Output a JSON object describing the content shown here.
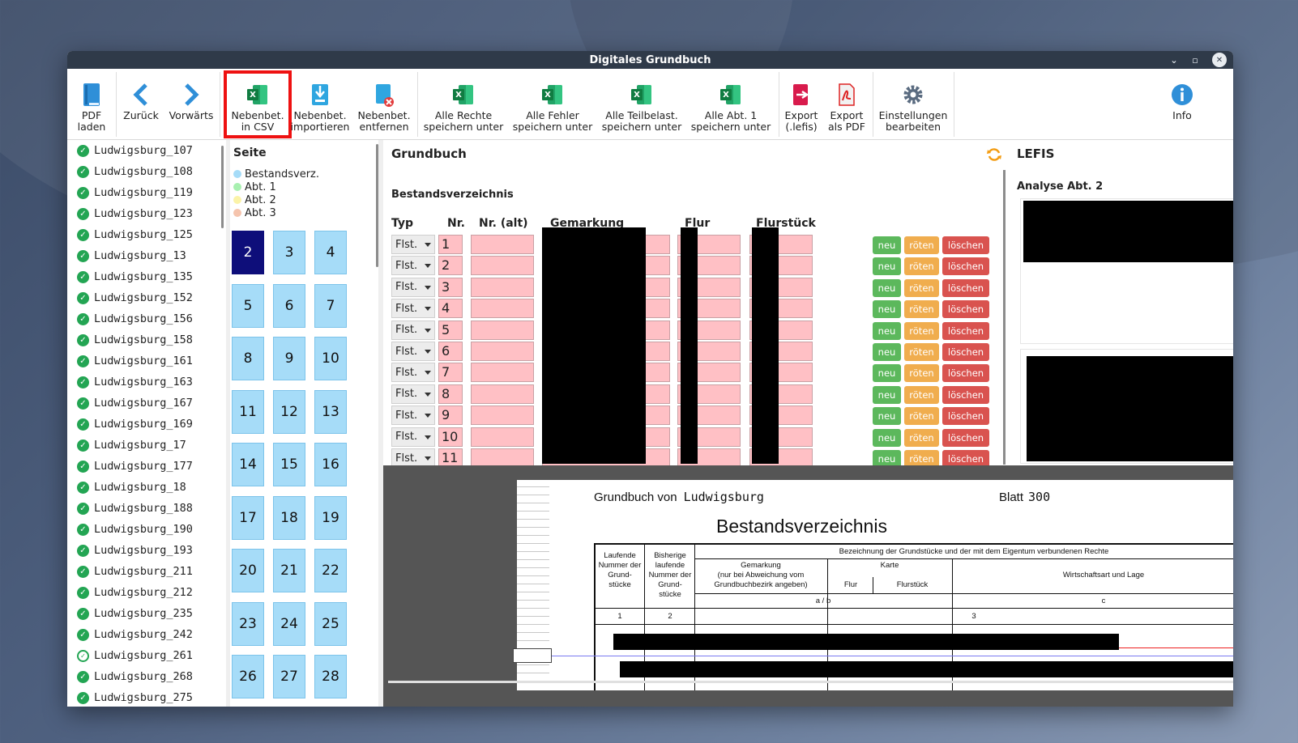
{
  "window": {
    "title": "Digitales Grundbuch"
  },
  "toolbar": {
    "pdf_laden": [
      "PDF",
      "laden"
    ],
    "zurueck": "Zurück",
    "vorwaerts": "Vorwärts",
    "nebenbet_csv": [
      "Nebenbet.",
      "in CSV"
    ],
    "nebenbet_import": [
      "Nebenbet.",
      "importieren"
    ],
    "nebenbet_entfernen": [
      "Nebenbet.",
      "entfernen"
    ],
    "alle_rechte": [
      "Alle Rechte",
      "speichern unter"
    ],
    "alle_fehler": [
      "Alle Fehler",
      "speichern unter"
    ],
    "alle_teilbelast": [
      "Alle Teilbelast.",
      "speichern unter"
    ],
    "alle_abt1": [
      "Alle Abt. 1",
      "speichern unter"
    ],
    "export_lefis": [
      "Export",
      "(.lefis)"
    ],
    "export_pdf": [
      "Export",
      "als PDF"
    ],
    "einstellungen": [
      "Einstellungen",
      "bearbeiten"
    ],
    "info": "Info"
  },
  "files": [
    {
      "name": "Ludwigsburg_107",
      "status": "checked"
    },
    {
      "name": "Ludwigsburg_108",
      "status": "checked"
    },
    {
      "name": "Ludwigsburg_119",
      "status": "checked"
    },
    {
      "name": "Ludwigsburg_123",
      "status": "checked"
    },
    {
      "name": "Ludwigsburg_125",
      "status": "checked"
    },
    {
      "name": "Ludwigsburg_13",
      "status": "checked"
    },
    {
      "name": "Ludwigsburg_135",
      "status": "checked"
    },
    {
      "name": "Ludwigsburg_152",
      "status": "checked"
    },
    {
      "name": "Ludwigsburg_156",
      "status": "checked"
    },
    {
      "name": "Ludwigsburg_158",
      "status": "checked"
    },
    {
      "name": "Ludwigsburg_161",
      "status": "checked"
    },
    {
      "name": "Ludwigsburg_163",
      "status": "checked"
    },
    {
      "name": "Ludwigsburg_167",
      "status": "checked"
    },
    {
      "name": "Ludwigsburg_169",
      "status": "checked"
    },
    {
      "name": "Ludwigsburg_17",
      "status": "checked"
    },
    {
      "name": "Ludwigsburg_177",
      "status": "checked"
    },
    {
      "name": "Ludwigsburg_18",
      "status": "checked"
    },
    {
      "name": "Ludwigsburg_188",
      "status": "checked"
    },
    {
      "name": "Ludwigsburg_190",
      "status": "checked"
    },
    {
      "name": "Ludwigsburg_193",
      "status": "checked"
    },
    {
      "name": "Ludwigsburg_211",
      "status": "checked"
    },
    {
      "name": "Ludwigsburg_212",
      "status": "checked"
    },
    {
      "name": "Ludwigsburg_235",
      "status": "checked"
    },
    {
      "name": "Ludwigsburg_242",
      "status": "checked"
    },
    {
      "name": "Ludwigsburg_261",
      "status": "outline"
    },
    {
      "name": "Ludwigsburg_268",
      "status": "checked"
    },
    {
      "name": "Ludwigsburg_275",
      "status": "checked"
    }
  ],
  "seite": {
    "title": "Seite",
    "legend": [
      {
        "label": "Bestandsverz.",
        "color": "#a6dcf8"
      },
      {
        "label": "Abt. 1",
        "color": "#a8f0b0"
      },
      {
        "label": "Abt. 2",
        "color": "#fbf3a8"
      },
      {
        "label": "Abt. 3",
        "color": "#f5c4ad"
      }
    ],
    "pages": [
      "2",
      "3",
      "4",
      "5",
      "6",
      "7",
      "8",
      "9",
      "10",
      "11",
      "12",
      "13",
      "14",
      "15",
      "16",
      "17",
      "18",
      "19",
      "20",
      "21",
      "22",
      "23",
      "24",
      "25",
      "26",
      "27",
      "28"
    ],
    "active_page": "2"
  },
  "grundbuch": {
    "title": "Grundbuch",
    "section": "Bestandsverzeichnis",
    "headers": {
      "typ": "Typ",
      "nr": "Nr.",
      "nr_alt": "Nr. (alt)",
      "gemarkung": "Gemarkung",
      "flur": "Flur",
      "flurstueck": "Flurstück"
    },
    "rows": [
      {
        "typ": "Flst.",
        "nr": "1"
      },
      {
        "typ": "Flst.",
        "nr": "2"
      },
      {
        "typ": "Flst.",
        "nr": "3"
      },
      {
        "typ": "Flst.",
        "nr": "4"
      },
      {
        "typ": "Flst.",
        "nr": "5"
      },
      {
        "typ": "Flst.",
        "nr": "6"
      },
      {
        "typ": "Flst.",
        "nr": "7"
      },
      {
        "typ": "Flst.",
        "nr": "8"
      },
      {
        "typ": "Flst.",
        "nr": "9"
      },
      {
        "typ": "Flst.",
        "nr": "10"
      },
      {
        "typ": "Flst.",
        "nr": "11"
      }
    ],
    "buttons": {
      "neu": "neu",
      "roeten": "röten",
      "loeschen": "löschen"
    }
  },
  "lefis": {
    "title": "LEFIS",
    "analyse": "Analyse Abt. 2"
  },
  "document": {
    "grundbuch_von_label": "Grundbuch von",
    "grundbuch_von_value": "Ludwigsburg",
    "blatt_label": "Blatt",
    "blatt_value": "300",
    "heading": "Bestandsverzeichnis",
    "col_laufende": "Laufende Nummer der Grund- stücke",
    "col_bisherige": "Bisherige laufende Nummer der Grund- stücke",
    "col_bezeichnung": "Bezeichnung der Grundstücke und der mit dem Eigentum verbundenen Rechte",
    "col_gemarkung": "Gemarkung",
    "col_gemarkung_note": "(nur bei Abweichung vom Grundbuchbezirk angeben)",
    "col_karte": "Karte",
    "col_flur": "Flur",
    "col_flurstueck": "Flurstück",
    "col_wirtschaft": "Wirtschaftsart und Lage",
    "col_ab": "a / b",
    "col_c": "c",
    "num1": "1",
    "num2": "2",
    "num3": "3"
  },
  "colors": {
    "titlebar": "#2f3a49",
    "page_button": "#a6dcf8",
    "page_active": "#0e0e7a",
    "field_pink": "#ffc0c5",
    "btn_neu": "#5cb85c",
    "btn_roeten": "#f0ad4e",
    "btn_loeschen": "#d9534f",
    "highlight": "#ee1111"
  }
}
